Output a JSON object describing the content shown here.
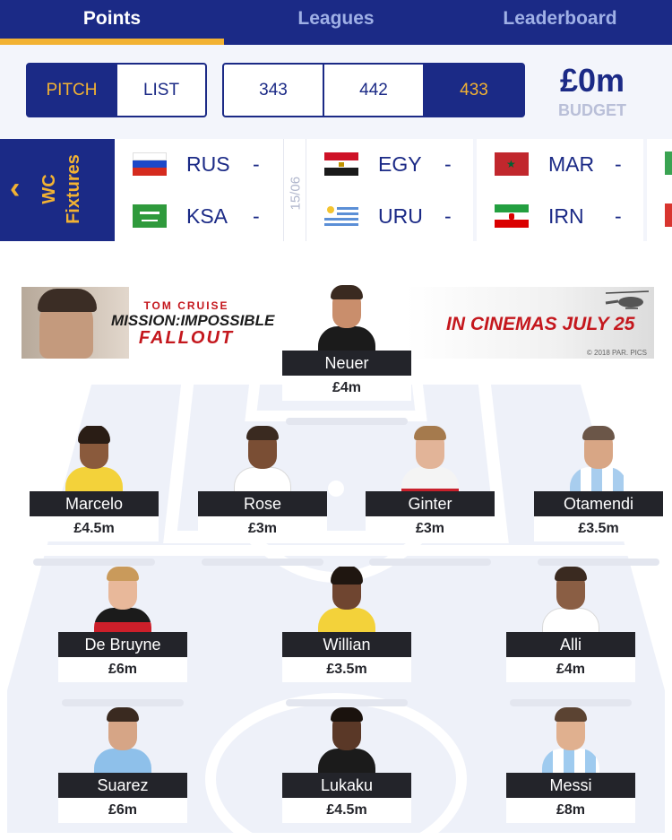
{
  "tabs": [
    {
      "label": "Points",
      "active": true
    },
    {
      "label": "Leagues",
      "active": false
    },
    {
      "label": "Leaderboard",
      "active": false
    }
  ],
  "view_toggle": {
    "options": [
      "PITCH",
      "LIST"
    ],
    "selected": "PITCH"
  },
  "formation": {
    "options": [
      "343",
      "442",
      "433"
    ],
    "selected": "433"
  },
  "budget": {
    "value": "£0m",
    "label": "BUDGET"
  },
  "fixtures": {
    "button_label_1": "WC",
    "button_label_2": "Fixtures",
    "date": "15/06",
    "matches": [
      {
        "home": "RUS",
        "home_score": "-",
        "away": "KSA",
        "away_score": "-"
      },
      {
        "home": "EGY",
        "home_score": "-",
        "away": "URU",
        "away_score": "-"
      },
      {
        "home": "MAR",
        "home_score": "-",
        "away": "IRN",
        "away_score": "-"
      }
    ]
  },
  "ad": {
    "line1": "TOM CRUISE",
    "line2": "MISSION:IMPOSSIBLE",
    "line3": "FALLOUT",
    "tagline": "IN CINEMAS JULY 25",
    "copyright": "© 2018 PAR. PICS"
  },
  "players": [
    {
      "name": "Neuer",
      "price": "£4m",
      "kit": "#1b1b1b"
    },
    {
      "name": "Marcelo",
      "price": "£4.5m",
      "kit": "#f3d23a"
    },
    {
      "name": "Rose",
      "price": "£3m",
      "kit": "#ffffff"
    },
    {
      "name": "Ginter",
      "price": "£3m",
      "kit": "#f4f4f4"
    },
    {
      "name": "Otamendi",
      "price": "£3.5m",
      "kit": "#a8cdee"
    },
    {
      "name": "De Bruyne",
      "price": "£6m",
      "kit": "#cc1f2a"
    },
    {
      "name": "Willian",
      "price": "£3.5m",
      "kit": "#f3d23a"
    },
    {
      "name": "Alli",
      "price": "£4m",
      "kit": "#ffffff"
    },
    {
      "name": "Suarez",
      "price": "£6m",
      "kit": "#8ec0ea"
    },
    {
      "name": "Lukaku",
      "price": "£4.5m",
      "kit": "#1b1b1b"
    },
    {
      "name": "Messi",
      "price": "£8m",
      "kit": "#9fcbef"
    }
  ]
}
